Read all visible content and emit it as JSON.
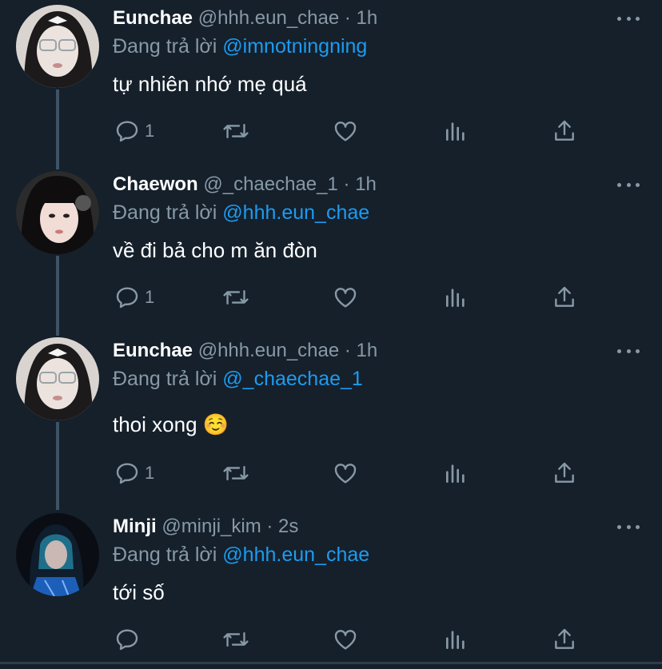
{
  "colors": {
    "background": "#15202b",
    "text_primary": "#ffffff",
    "text_secondary": "#8899a6",
    "mention": "#1d9bf0",
    "thread_line": "#3d5466"
  },
  "reply_prefix": "Đang trả lời",
  "tweets": [
    {
      "name": "Eunchae",
      "handle": "@hhh.eun_chae",
      "time": "· 1h",
      "reply_to": "@imnotningning",
      "text": "tự nhiên nhớ mẹ quá",
      "reply_count": "1"
    },
    {
      "name": "Chaewon",
      "handle": "@_chaechae_1",
      "time": "· 1h",
      "reply_to": "@hhh.eun_chae",
      "text": "về đi bả cho m ăn đòn",
      "reply_count": "1"
    },
    {
      "name": "Eunchae",
      "handle": "@hhh.eun_chae",
      "time": "· 1h",
      "reply_to": "@_chaechae_1",
      "text": "thoi xong ☺️",
      "reply_count": "1"
    },
    {
      "name": "Minji",
      "handle": "@minji_kim",
      "time": "· 2s",
      "reply_to": "@hhh.eun_chae",
      "text": "tới số",
      "reply_count": ""
    }
  ],
  "icons": [
    "reply-icon",
    "retweet-icon",
    "like-icon",
    "views-icon",
    "share-icon",
    "more-icon"
  ]
}
